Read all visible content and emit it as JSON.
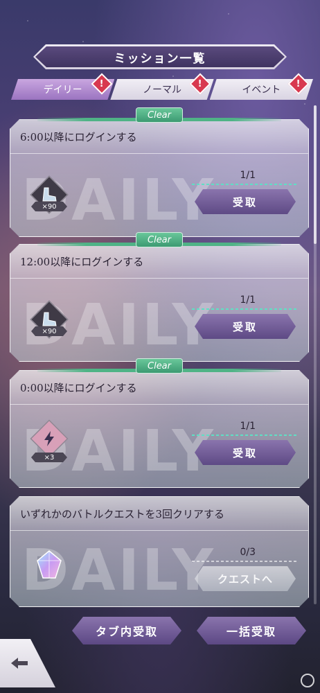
{
  "header": {
    "title": "ミッション一覧"
  },
  "tabs": [
    {
      "label": "デイリー",
      "active": true,
      "badge": "!"
    },
    {
      "label": "ノーマル",
      "active": false,
      "badge": "!"
    },
    {
      "label": "イベント",
      "active": false,
      "badge": "!"
    }
  ],
  "missions": [
    {
      "text": "6:00以降にログインする",
      "progress": "1/1",
      "button": "受取",
      "reward_qty": "×90",
      "reward_icon": "boot-icon",
      "cleared": true,
      "clear_label": "Clear",
      "watermark": "DAILY"
    },
    {
      "text": "12:00以降にログインする",
      "progress": "1/1",
      "button": "受取",
      "reward_qty": "×90",
      "reward_icon": "boot-icon",
      "cleared": true,
      "clear_label": "Clear",
      "watermark": "DAILY"
    },
    {
      "text": "0:00以降にログインする",
      "progress": "1/1",
      "button": "受取",
      "reward_qty": "×3",
      "reward_icon": "lightning-icon",
      "cleared": true,
      "clear_label": "Clear",
      "watermark": "DAILY"
    },
    {
      "text": "いずれかのバトルクエストを3回クリアする",
      "progress": "0/3",
      "button": "クエストへ",
      "reward_icon": "crystal-icon",
      "cleared": false,
      "watermark": "DAILY"
    }
  ],
  "footer": {
    "tab_receive": "タブ内受取",
    "bulk_receive": "一括受取"
  },
  "colors": {
    "accent": "#6b5693",
    "clear_green": "#4fb386",
    "badge_red": "#d8394f"
  }
}
